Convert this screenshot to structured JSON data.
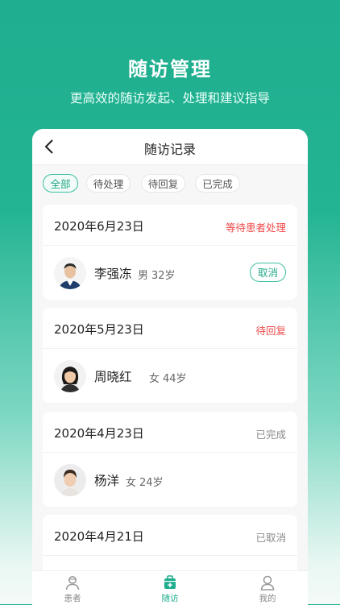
{
  "hero": {
    "title": "随访管理",
    "subtitle": "更高效的随访发起、处理和建议指导"
  },
  "header": {
    "title": "随访记录",
    "back_icon": "chevron-left-icon"
  },
  "filters": [
    "全部",
    "待处理",
    "待回复",
    "已完成"
  ],
  "active_filter": "全部",
  "records": [
    {
      "date": "2020年6月23日",
      "status": "等待患者处理",
      "status_color": "#f04a4a",
      "name": "李强冻",
      "gender": "男",
      "age": "32岁",
      "action": "取消"
    },
    {
      "date": "2020年5月23日",
      "status": "待回复",
      "status_color": "#f04a4a",
      "name": "周晓红",
      "gender": "女",
      "age": "44岁"
    },
    {
      "date": "2020年4月23日",
      "status": "已完成",
      "status_color": "#8a8a8a",
      "name": "杨洋",
      "gender": "女",
      "age": "24岁"
    },
    {
      "date": "2020年4月21日",
      "status": "已取消",
      "status_color": "#8a8a8a"
    }
  ],
  "tabbar": [
    {
      "label": "患者",
      "icon": "patient-icon"
    },
    {
      "label": "随访",
      "icon": "medical-kit-icon"
    },
    {
      "label": "我的",
      "icon": "profile-icon"
    }
  ],
  "active_tab": "随访",
  "colors": {
    "accent": "#1fae8f",
    "alert": "#f04a4a"
  }
}
